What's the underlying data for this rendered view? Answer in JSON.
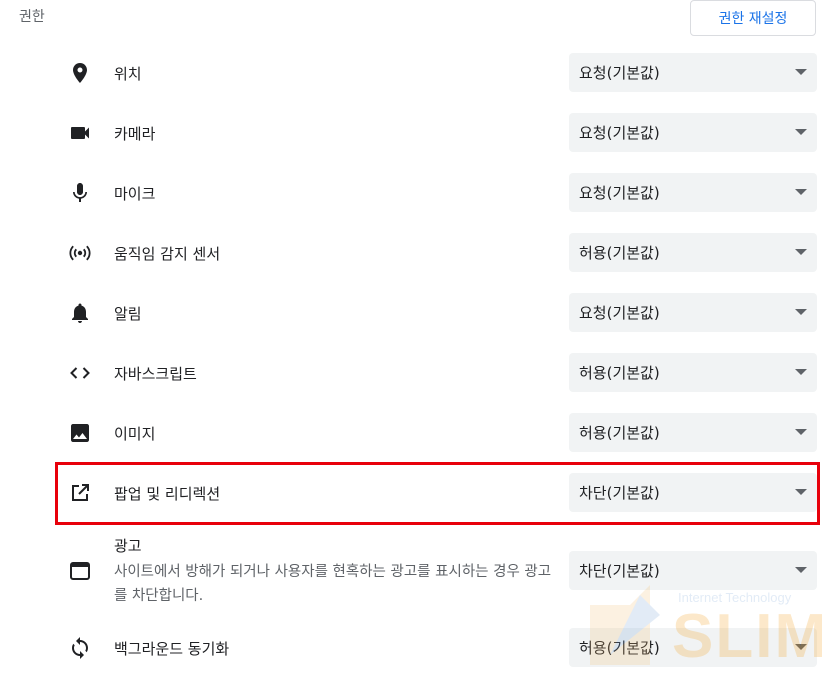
{
  "header": {
    "title": "권한",
    "reset_button": "권한 재설정"
  },
  "permissions": [
    {
      "icon": "location-pin-icon",
      "label": "위치",
      "value": "요청(기본값)"
    },
    {
      "icon": "camera-icon",
      "label": "카메라",
      "value": "요청(기본값)"
    },
    {
      "icon": "microphone-icon",
      "label": "마이크",
      "value": "요청(기본값)"
    },
    {
      "icon": "motion-sensor-icon",
      "label": "움직임 감지 센서",
      "value": "허용(기본값)"
    },
    {
      "icon": "bell-icon",
      "label": "알림",
      "value": "요청(기본값)"
    },
    {
      "icon": "code-icon",
      "label": "자바스크립트",
      "value": "허용(기본값)"
    },
    {
      "icon": "image-icon",
      "label": "이미지",
      "value": "허용(기본값)"
    },
    {
      "icon": "open-in-new-icon",
      "label": "팝업 및 리디렉션",
      "value": "차단(기본값)"
    },
    {
      "icon": "ads-window-icon",
      "label": "광고",
      "description": "사이트에서 방해가 되거나 사용자를 현혹하는 광고를 표시하는 경우 광고를 차단합니다.",
      "value": "차단(기본값)"
    },
    {
      "icon": "sync-icon",
      "label": "백그라운드 동기화",
      "value": "허용(기본값)"
    }
  ],
  "watermark": {
    "subtitle": "Internet Technology",
    "brand": "SLIM"
  },
  "colors": {
    "accent": "#1a73e8",
    "highlight_border": "#e8000b",
    "select_bg": "#f1f3f4",
    "icon": "#5f6368"
  }
}
